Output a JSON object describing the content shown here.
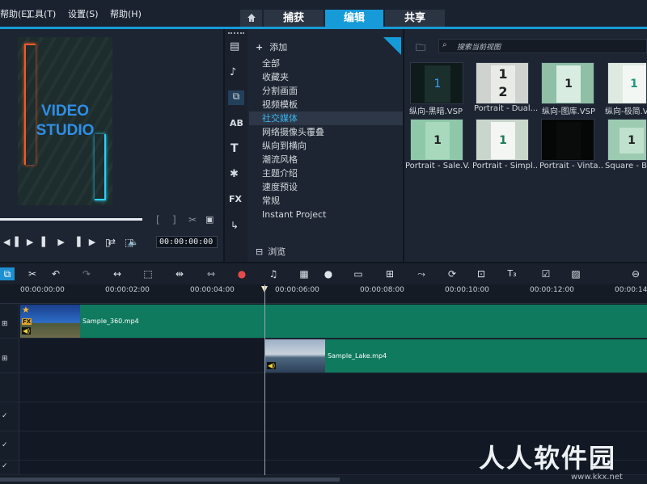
{
  "menu": [
    "帮助(E)",
    "工具(T)",
    "设置(S)",
    "帮助(H)"
  ],
  "tabs": {
    "home_icon": "home-icon",
    "capture": "捕获",
    "edit": "编辑",
    "share": "共享"
  },
  "preview": {
    "line1": "VIDEO",
    "line2": "STUDIO",
    "timecode": "00:00:00:00"
  },
  "library": {
    "add_label": "添加",
    "categories": [
      "全部",
      "收藏夹",
      "分割画面",
      "视频模板",
      "社交媒体",
      "网络摄像头覆叠",
      "纵向到横向",
      "潮流风格",
      "主题介绍",
      "速度预设",
      "常规",
      "Instant Project"
    ],
    "selected": "社交媒体",
    "browse_label": "浏览",
    "search_placeholder": "搜索当前视图",
    "thumbnails": [
      {
        "label": "纵向-黑暗.VSP"
      },
      {
        "label": "Portrait - Dual..."
      },
      {
        "label": "纵向-图库.VSP"
      },
      {
        "label": "纵向-极简.V"
      },
      {
        "label": "Portrait - Sale.V..."
      },
      {
        "label": "Portrait - Simpl..."
      },
      {
        "label": "Portrait - Vinta..."
      },
      {
        "label": "Square - Ba"
      }
    ]
  },
  "ruler": [
    "00:00:00:00",
    "00:00:02:00",
    "00:00:04:00",
    "00:00:06:00",
    "00:00:08:00",
    "00:00:10:00",
    "00:00:12:00",
    "00:00:14"
  ],
  "clips": {
    "clip1": "Sample_360.mp4",
    "clip2": "Sample_Lake.mp4"
  },
  "watermark": {
    "text": "人人软件园",
    "url": "www.kkx.net"
  }
}
